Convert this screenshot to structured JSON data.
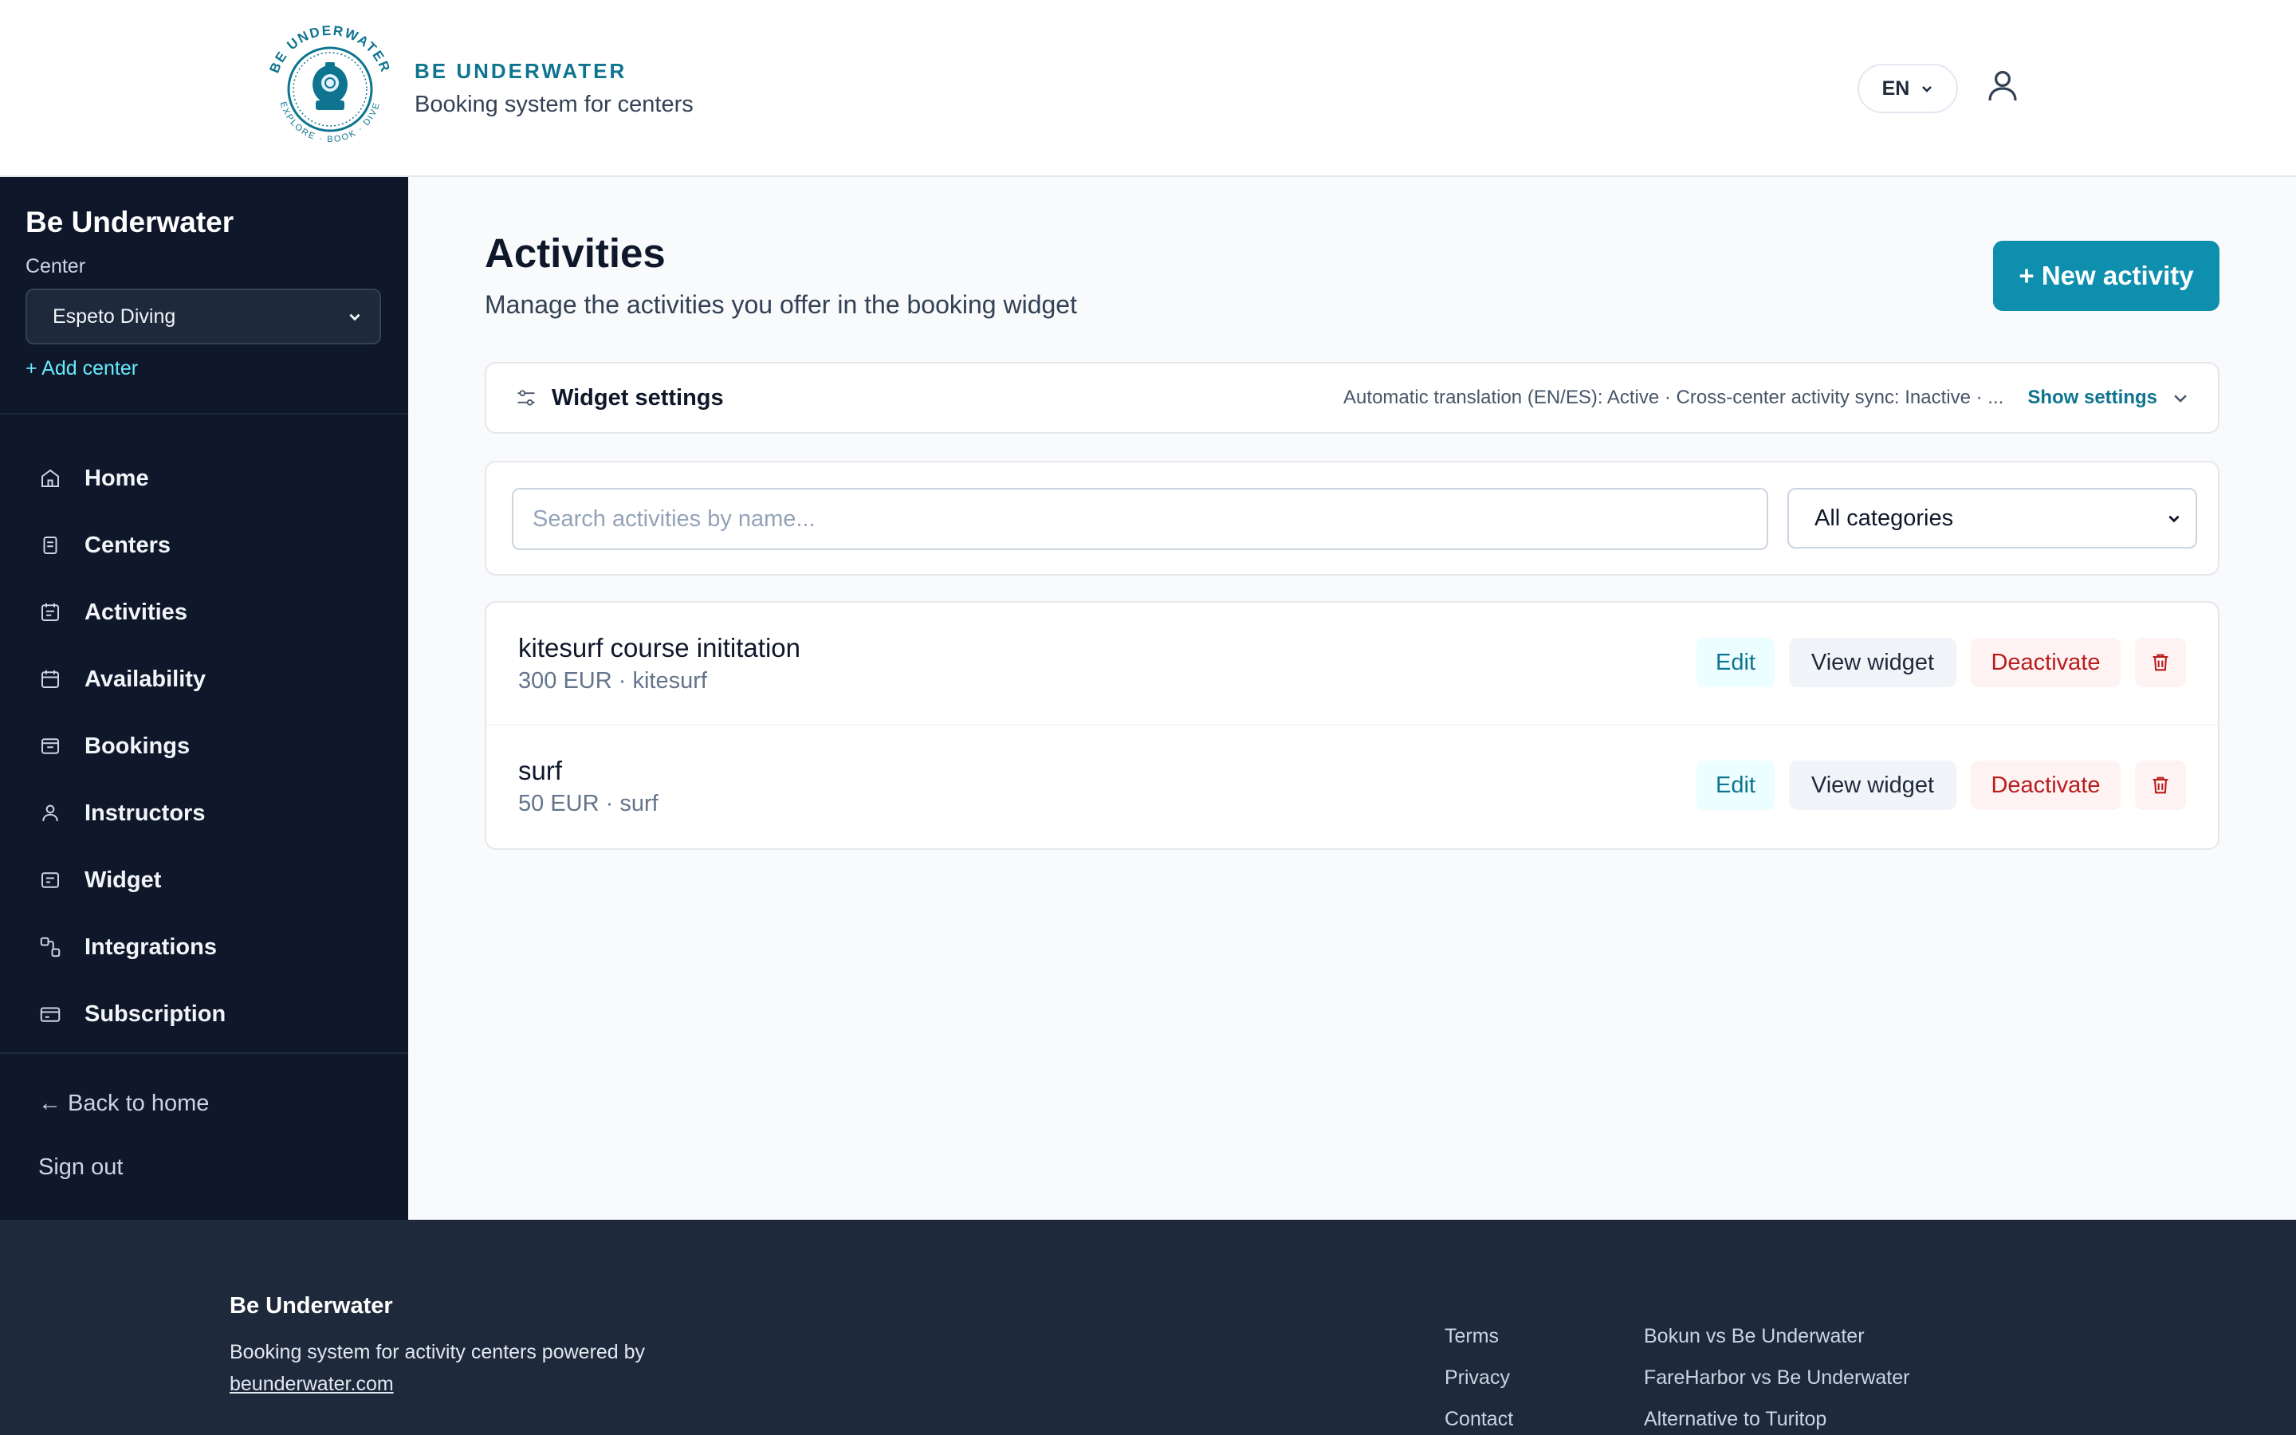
{
  "header": {
    "brand_name": "BE UNDERWATER",
    "brand_subtitle": "Booking system for centers",
    "logo_text": "BE UNDERWATER",
    "logo_tagline": "EXPLORE · BOOK · DIVE",
    "language": "EN"
  },
  "sidebar": {
    "title": "Be Underwater",
    "center_label": "Center",
    "center_value": "Espeto Diving",
    "add_center": "+ Add center",
    "items": [
      {
        "label": "Home",
        "icon": "home-icon"
      },
      {
        "label": "Centers",
        "icon": "building-icon"
      },
      {
        "label": "Activities",
        "icon": "calendar-list-icon"
      },
      {
        "label": "Availability",
        "icon": "calendar-icon"
      },
      {
        "label": "Bookings",
        "icon": "inbox-icon"
      },
      {
        "label": "Instructors",
        "icon": "person-icon"
      },
      {
        "label": "Widget",
        "icon": "widget-icon"
      },
      {
        "label": "Integrations",
        "icon": "integrations-icon"
      },
      {
        "label": "Subscription",
        "icon": "credit-card-icon"
      }
    ],
    "back_home": "← Back to home",
    "sign_out": "Sign out"
  },
  "main": {
    "title": "Activities",
    "subtitle": "Manage the activities you offer in the booking widget",
    "new_activity": "+ New activity",
    "widget_settings": {
      "title": "Widget settings",
      "status": "Automatic translation (EN/ES): Active · Cross-center activity sync: Inactive · ...",
      "toggle": "Show settings"
    },
    "search": {
      "placeholder": "Search activities by name...",
      "value": ""
    },
    "category_filter": "All categories",
    "activities": [
      {
        "name": "kitesurf course inititation",
        "meta": "300 EUR · kitesurf",
        "edit": "Edit",
        "view": "View widget",
        "deactivate": "Deactivate"
      },
      {
        "name": "surf",
        "meta": "50 EUR · surf",
        "edit": "Edit",
        "view": "View widget",
        "deactivate": "Deactivate"
      }
    ]
  },
  "footer": {
    "brand": "Be Underwater",
    "description": "Booking system for activity centers powered by",
    "site": "beunderwater.com",
    "links_col1": [
      "Terms",
      "Privacy",
      "Contact"
    ],
    "links_col2": [
      "Bokun vs Be Underwater",
      "FareHarbor vs Be Underwater",
      "Alternative to Turitop"
    ]
  },
  "colors": {
    "accent": "#0e8fae",
    "sidebar_bg": "#0f172a",
    "footer_bg": "#1e293b",
    "danger": "#b91c1c"
  }
}
